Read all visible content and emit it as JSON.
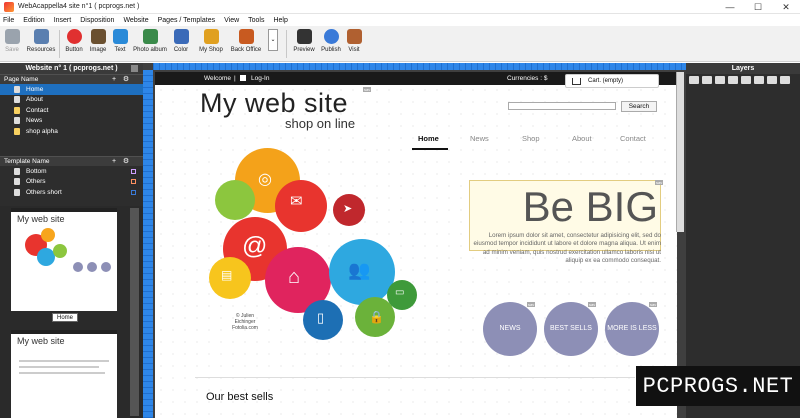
{
  "window": {
    "title": "WebAcappella4 site n°1 ( pcprogs.net )",
    "controls": [
      "—",
      "☐",
      "✕"
    ]
  },
  "menu": [
    "File",
    "Edition",
    "Insert",
    "Disposition",
    "Website",
    "Pages / Templates",
    "View",
    "Tools",
    "Help"
  ],
  "toolbar": [
    {
      "label": "Save",
      "icon": "save-icon",
      "color": "#9aa3ad",
      "disabled": true
    },
    {
      "label": "Resources",
      "icon": "resources-icon",
      "color": "#5a7fb0"
    },
    {
      "label": "Button",
      "icon": "button-icon",
      "color": "#e03030"
    },
    {
      "label": "Image",
      "icon": "image-icon",
      "color": "#6a5030"
    },
    {
      "label": "Text",
      "icon": "text-icon",
      "color": "#2a8ad8"
    },
    {
      "label": "Photo album",
      "icon": "photo-album-icon",
      "color": "#3a8a4a"
    },
    {
      "label": "Color",
      "icon": "color-icon",
      "color": "#3a6ab8"
    },
    {
      "label": "My Shop",
      "icon": "shop-icon",
      "color": "#e0a020"
    },
    {
      "label": "Back Office",
      "icon": "back-office-icon",
      "color": "#c85a20"
    },
    {
      "label": "Preview",
      "icon": "preview-icon",
      "color": "#333333"
    },
    {
      "label": "Publish",
      "icon": "publish-icon",
      "color": "#3a7ad8"
    },
    {
      "label": "Visit",
      "icon": "visit-icon",
      "color": "#b06030"
    }
  ],
  "left_panel": {
    "title": "Website n° 1 ( pcprogs.net )",
    "pages_header": "Page Name",
    "pages": [
      {
        "label": "Home",
        "selected": true
      },
      {
        "label": "About"
      },
      {
        "label": "Contact"
      },
      {
        "label": "News"
      },
      {
        "label": "shop alpha"
      }
    ],
    "templates_header": "Template Name",
    "templates": [
      {
        "label": "Bottom",
        "color": "#d0a0ff"
      },
      {
        "label": "Others",
        "color": "#ff9060"
      },
      {
        "label": "Others short",
        "color": "#3a7ad8"
      }
    ],
    "thumb_label": "Home",
    "thumb_logo": "My web site"
  },
  "site": {
    "top_welcome": "Welcome",
    "top_login": "Log-In",
    "currencies": "Currencies : $",
    "cart": "Cart. (empty)",
    "logo": "My web site",
    "subtitle": "shop on line",
    "search_button": "Search",
    "nav": [
      "Home",
      "News",
      "Shop",
      "About",
      "Contact"
    ],
    "hero_title": "Be BIG",
    "lorem": "Lorem ipsum dolor sit amet, consectetur adipisicing elit, sed do eiusmod tempor incididunt ut labore et dolore magna aliqua. Ut enim ad minim veniam, quis nostrud exercitation ullamco laboris nisi ut aliquip ex ea commodo consequat.",
    "circles": [
      "NEWS",
      "BEST SELLS",
      "MORE IS LESS"
    ],
    "credit": "© Julien Eichinger Fotolia.com",
    "section_title": "Our best sells",
    "tag": "sav"
  },
  "layers_panel": {
    "title": "Layers"
  },
  "watermark": "PCPROGS.NET",
  "colors": {
    "ruler": "#2e86e8",
    "panel": "#2d2d2d",
    "selection": "#1e6fbf",
    "circle": "#8d8fb6"
  }
}
